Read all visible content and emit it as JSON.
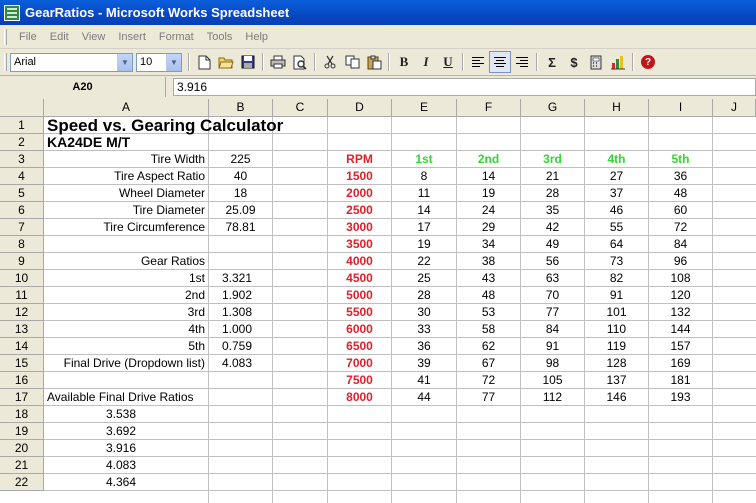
{
  "window": {
    "title": "GearRatios - Microsoft Works Spreadsheet"
  },
  "menu": [
    "File",
    "Edit",
    "View",
    "Insert",
    "Format",
    "Tools",
    "Help"
  ],
  "toolbar": {
    "font_name": "Arial",
    "font_size": "10",
    "bold": "B",
    "italic": "I",
    "underline": "U",
    "autosum": "Σ",
    "currency": "$"
  },
  "entry_bar": {
    "cell_ref": "A20",
    "value": "3.916"
  },
  "columns": [
    "A",
    "B",
    "C",
    "D",
    "E",
    "F",
    "G",
    "H",
    "I",
    "J"
  ],
  "rows": [
    "1",
    "2",
    "3",
    "4",
    "5",
    "6",
    "7",
    "8",
    "9",
    "10",
    "11",
    "12",
    "13",
    "14",
    "15",
    "16",
    "17",
    "18",
    "19",
    "20",
    "21",
    "22"
  ],
  "sheet": {
    "title": "Speed vs. Gearing Calculator",
    "subtitle": "KA24DE M/T",
    "inputs": [
      {
        "label": "Tire Width",
        "value": "225"
      },
      {
        "label": "Tire Aspect Ratio",
        "value": "40"
      },
      {
        "label": "Wheel Diameter",
        "value": "18"
      },
      {
        "label": "Tire Diameter",
        "value": "25.09"
      },
      {
        "label": "Tire Circumference",
        "value": "78.81"
      }
    ],
    "gear_ratios_label": "Gear Ratios",
    "gears": [
      {
        "label": "1st",
        "value": "3.321"
      },
      {
        "label": "2nd",
        "value": "1.902"
      },
      {
        "label": "3rd",
        "value": "1.308"
      },
      {
        "label": "4th",
        "value": "1.000"
      },
      {
        "label": "5th",
        "value": "0.759"
      }
    ],
    "final_drive": {
      "label": "Final Drive (Dropdown list)",
      "value": "4.083"
    },
    "available_label": "Available Final Drive Ratios",
    "available_ratios": [
      "3.538",
      "3.692",
      "3.916",
      "4.083",
      "4.364"
    ],
    "speed_table": {
      "headers": [
        "RPM",
        "1st",
        "2nd",
        "3rd",
        "4th",
        "5th"
      ],
      "rows": [
        [
          "1500",
          "8",
          "14",
          "21",
          "27",
          "36"
        ],
        [
          "2000",
          "11",
          "19",
          "28",
          "37",
          "48"
        ],
        [
          "2500",
          "14",
          "24",
          "35",
          "46",
          "60"
        ],
        [
          "3000",
          "17",
          "29",
          "42",
          "55",
          "72"
        ],
        [
          "3500",
          "19",
          "34",
          "49",
          "64",
          "84"
        ],
        [
          "4000",
          "22",
          "38",
          "56",
          "73",
          "96"
        ],
        [
          "4500",
          "25",
          "43",
          "63",
          "82",
          "108"
        ],
        [
          "5000",
          "28",
          "48",
          "70",
          "91",
          "120"
        ],
        [
          "5500",
          "30",
          "53",
          "77",
          "101",
          "132"
        ],
        [
          "6000",
          "33",
          "58",
          "84",
          "110",
          "144"
        ],
        [
          "6500",
          "36",
          "62",
          "91",
          "119",
          "157"
        ],
        [
          "7000",
          "39",
          "67",
          "98",
          "128",
          "169"
        ],
        [
          "7500",
          "41",
          "72",
          "105",
          "137",
          "181"
        ],
        [
          "8000",
          "44",
          "77",
          "112",
          "146",
          "193"
        ]
      ]
    }
  },
  "colors": {
    "rpm": "#E0202A",
    "gear_header": "#33D633",
    "title_bar": "#0A5FDB"
  }
}
